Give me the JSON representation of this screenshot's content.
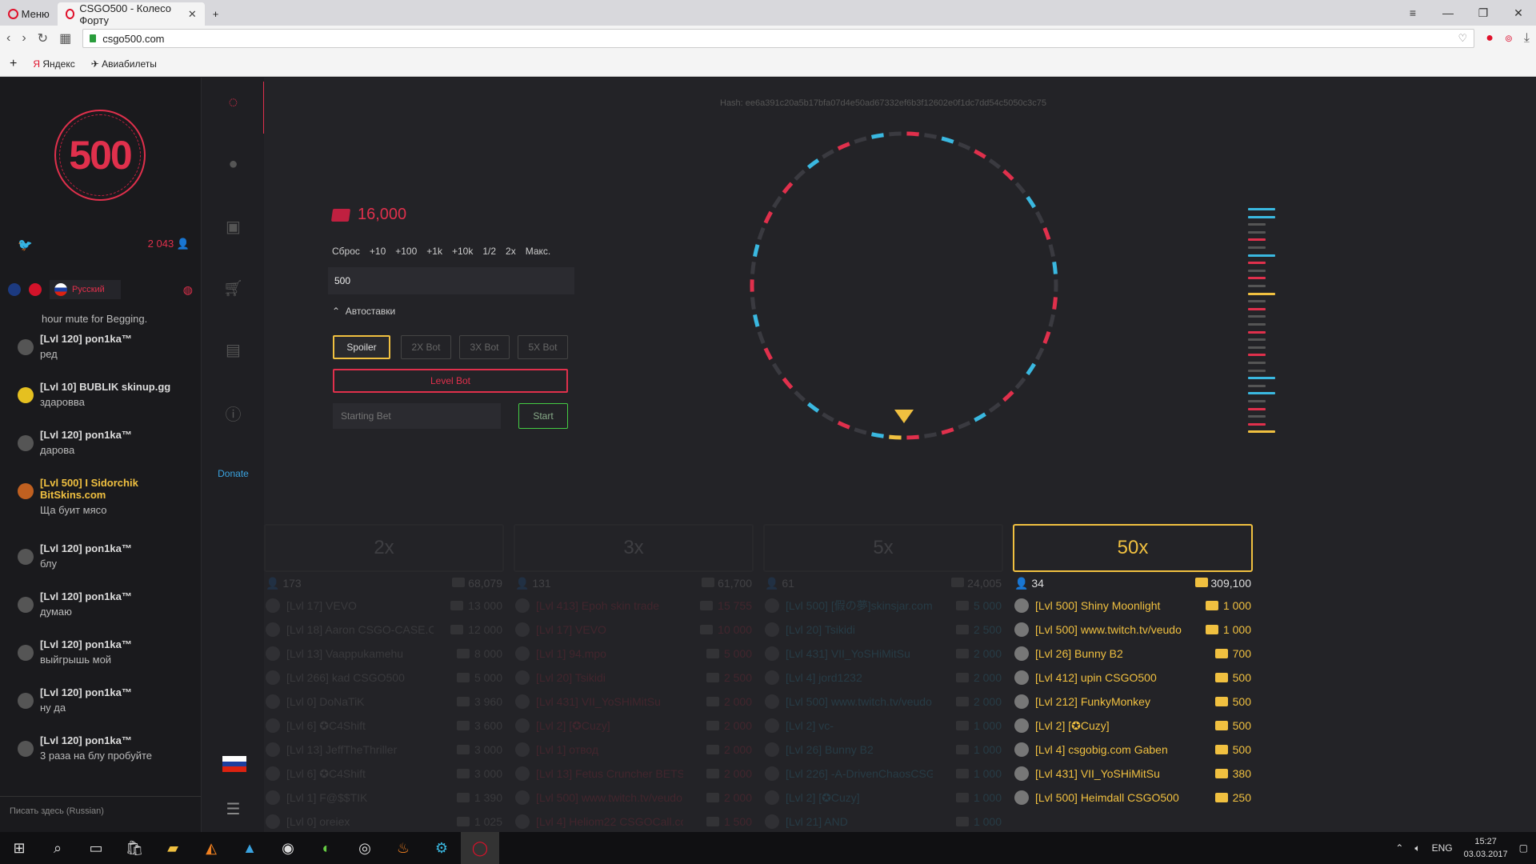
{
  "browser": {
    "menu_label": "Меню",
    "tab_title": "CSGO500 - Колесо Форту",
    "url": "csgo500.com",
    "bookmarks": [
      "Яндекс",
      "Авиабилеты"
    ]
  },
  "sidebar": {
    "logo": "500",
    "online": "2 043",
    "language": "Русский",
    "chat": [
      {
        "name": "",
        "text": "hour mute for Begging."
      },
      {
        "name": "[Lvl 120] pon1ka™",
        "text": "ред"
      },
      {
        "name": "[Lvl 10] BUBLIK skinup.gg",
        "text": "здаровва"
      },
      {
        "name": "[Lvl 120] pon1ka™",
        "text": "дарова"
      },
      {
        "name": "[Lvl 500] I Sidorchik BitSkins.com",
        "text": "Ща буит мясо"
      },
      {
        "name": "[Lvl 120] pon1ka™",
        "text": "блу"
      },
      {
        "name": "[Lvl 120] pon1ka™",
        "text": "думаю"
      },
      {
        "name": "[Lvl 120] pon1ka™",
        "text": "выйгрышь мой"
      },
      {
        "name": "[Lvl 120] pon1ka™",
        "text": "ну да"
      },
      {
        "name": "[Lvl 120] pon1ka™",
        "text": "3 раза на блу пробуйте"
      }
    ],
    "chat_placeholder": "Писать здесь (Russian)"
  },
  "nav": {
    "donate": "Donate"
  },
  "game": {
    "hash": "Hash: ee6a391c20a5b17bfa07d4e50ad67332ef6b3f12602e0f1dc7dd54c5050c3c75",
    "balance": "16,000",
    "bet_buttons": [
      "Сброс",
      "+10",
      "+100",
      "+1k",
      "+10k",
      "1/2",
      "2x",
      "Макс."
    ],
    "bet_value": "500",
    "auto_label": "Автоставки",
    "spoiler": "Spoiler",
    "b2x": "2X Bot",
    "b3x": "3X Bot",
    "b5x": "5X Bot",
    "level_bot": "Level Bot",
    "starting_bet_placeholder": "Starting Bet",
    "start": "Start"
  },
  "columns": [
    {
      "label": "2x",
      "players": "173",
      "total": "68,079",
      "cls": "grey",
      "rows": [
        [
          "[Lvl 17] VEVO",
          "13 000"
        ],
        [
          "[Lvl 18] Aaron CSGO-CASE.C",
          "12 000"
        ],
        [
          "[Lvl 13] Vaappukamehu",
          "8 000"
        ],
        [
          "[Lvl 266] kad CSGO500",
          "5 000"
        ],
        [
          "[Lvl 0] DoNaTiK",
          "3 960"
        ],
        [
          "[Lvl 6] ✪C4Shift",
          "3 600"
        ],
        [
          "[Lvl 13] JeffTheThriller",
          "3 000"
        ],
        [
          "[Lvl 6] ✪C4Shift",
          "3 000"
        ],
        [
          "[Lvl 1] F@$$TIK",
          "1 390"
        ],
        [
          "[Lvl 0] oreiex",
          "1 025"
        ]
      ]
    },
    {
      "label": "3x",
      "players": "131",
      "total": "61,700",
      "cls": "red",
      "rows": [
        [
          "[Lvl 413] Epoh skin trade",
          "15 755"
        ],
        [
          "[Lvl 17] VEVO",
          "10 000"
        ],
        [
          "[Lvl 1] 94.mpo",
          "5 000"
        ],
        [
          "[Lvl 20] Tsikidi",
          "2 500"
        ],
        [
          "[Lvl 431] VII_YoSHiMitSu",
          "2 000"
        ],
        [
          "[Lvl 2] [✪Cuzy]",
          "2 000"
        ],
        [
          "[Lvl 1] отвод",
          "2 000"
        ],
        [
          "[Lvl 13] Fetus Cruncher BETS",
          "2 000"
        ],
        [
          "[Lvl 500] www.twitch.tv/veudo",
          "2 000"
        ],
        [
          "[Lvl 4] Heliom22 CSGOCall.cor",
          "1 500"
        ]
      ]
    },
    {
      "label": "5x",
      "players": "61",
      "total": "24,005",
      "cls": "blue",
      "rows": [
        [
          "[Lvl 500] [假の夢]skinsjar.com",
          "5 000"
        ],
        [
          "[Lvl 20] Tsikidi",
          "2 500"
        ],
        [
          "[Lvl 431] VII_YoSHiMitSu",
          "2 000"
        ],
        [
          "[Lvl 4] jord1232",
          "2 000"
        ],
        [
          "[Lvl 500] www.twitch.tv/veudo",
          "2 000"
        ],
        [
          "[Lvl 2] vc-",
          "1 000"
        ],
        [
          "[Lvl 26] Bunny B2",
          "1 000"
        ],
        [
          "[Lvl 226] -A-DrivenChaosCSGO",
          "1 000"
        ],
        [
          "[Lvl 2] [✪Cuzy]",
          "1 000"
        ],
        [
          "[Lvl 21] AND",
          "1 000"
        ]
      ]
    },
    {
      "label": "50x",
      "players": "34",
      "total": "309,100",
      "cls": "gold",
      "rows": [
        [
          "[Lvl 500] Shiny Moonlight",
          "1 000"
        ],
        [
          "[Lvl 500] www.twitch.tv/veudo",
          "1 000"
        ],
        [
          "[Lvl 26] Bunny B2",
          "700"
        ],
        [
          "[Lvl 412] upin CSGO500",
          "500"
        ],
        [
          "[Lvl 212] FunkyMonkey",
          "500"
        ],
        [
          "[Lvl 2] [✪Cuzy]",
          "500"
        ],
        [
          "[Lvl 4] csgobig.com Gaben",
          "500"
        ],
        [
          "[Lvl 431] VII_YoSHiMitSu",
          "380"
        ],
        [
          "[Lvl 500] Heimdall CSGO500",
          "250"
        ]
      ]
    }
  ],
  "taskbar": {
    "lang": "ENG",
    "time": "15:27",
    "date": "03.03.2017"
  },
  "colors": {
    "red": "#e0304c",
    "blue": "#3ab8e0",
    "gold": "#f0c040",
    "grey": "#3a3a40"
  }
}
